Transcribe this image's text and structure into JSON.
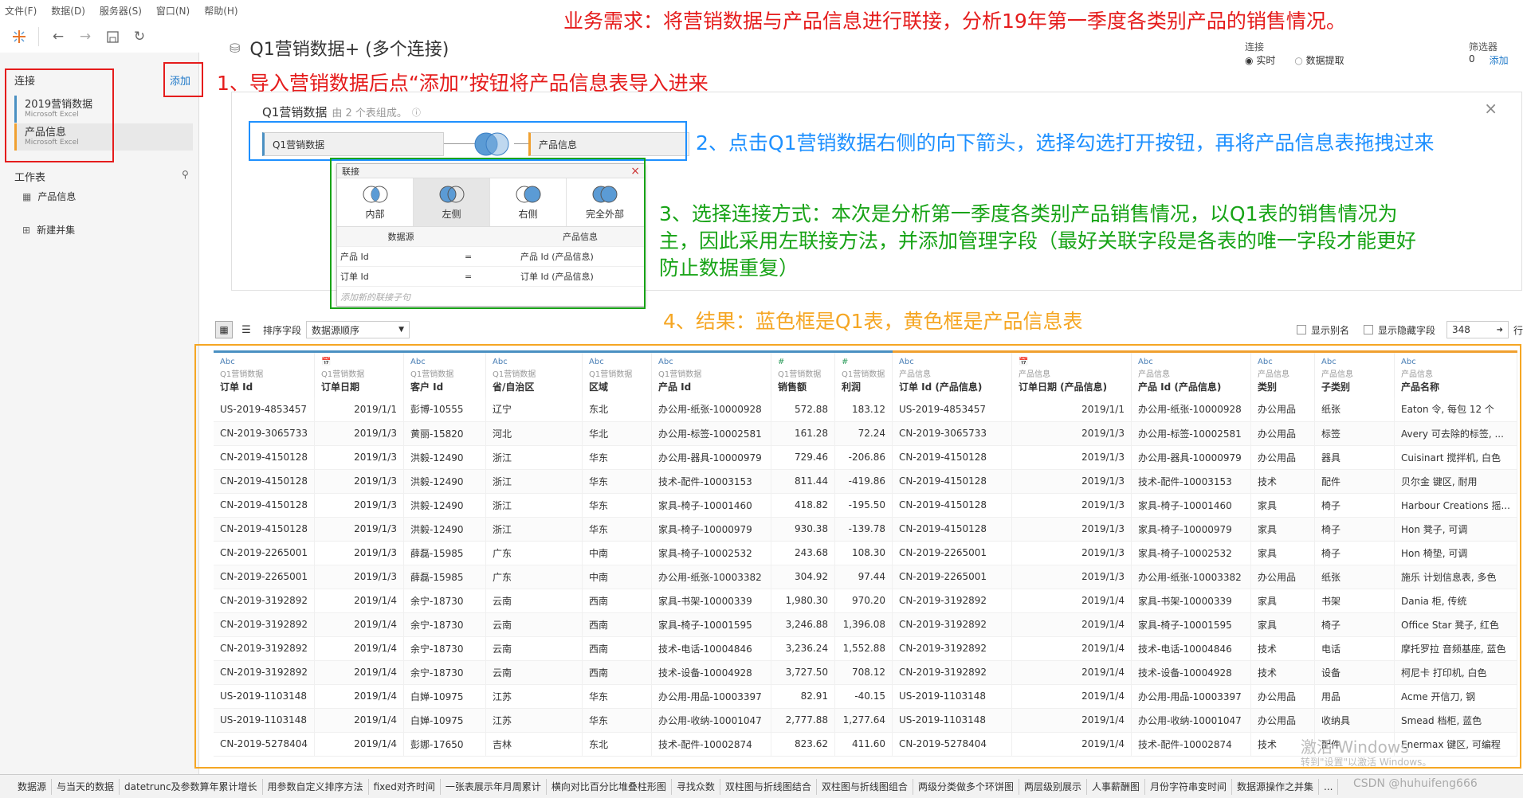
{
  "menu": [
    "文件(F)",
    "数据(D)",
    "服务器(S)",
    "窗口(N)",
    "帮助(H)"
  ],
  "datasource": {
    "title": "Q1营销数据+ (多个连接)"
  },
  "connection_mode": {
    "label": "连接",
    "options": [
      "实时",
      "数据提取"
    ],
    "selected": "实时"
  },
  "filters": {
    "label": "筛选器",
    "count": "0",
    "add": "添加"
  },
  "left": {
    "connections_label": "连接",
    "add_label": "添加",
    "connections": [
      {
        "name": "2019营销数据",
        "type": "Microsoft Excel"
      },
      {
        "name": "产品信息",
        "type": "Microsoft Excel"
      }
    ],
    "sheets_label": "工作表",
    "sheets": [
      {
        "name": "产品信息"
      }
    ],
    "new_union": "新建并集"
  },
  "canvas": {
    "title": "Q1营销数据",
    "subtitle": "由 2 个表组成。",
    "left_table": "Q1营销数据",
    "right_table": "产品信息"
  },
  "join_dialog": {
    "title": "联接",
    "types": [
      "内部",
      "左侧",
      "右侧",
      "完全外部"
    ],
    "selected": "左侧",
    "col_left": "数据源",
    "col_right": "产品信息",
    "clauses": [
      {
        "left": "产品 Id",
        "op": "=",
        "right": "产品 Id (产品信息)"
      },
      {
        "left": "订单 Id",
        "op": "=",
        "right": "订单 Id (产品信息)"
      }
    ],
    "add_clause": "添加新的联接子句"
  },
  "annotations": {
    "top": "业务需求：将营销数据与产品信息进行联接，分析19年第一季度各类别产品的销售情况。",
    "a1": "1、导入营销数据后点“添加”按钮将产品信息表导入进来",
    "a2": "2、点击Q1营销数据右侧的向下箭头，选择勾选打开按钮，再将产品信息表拖拽过来",
    "a3_l1": "3、选择连接方式：本次是分析第一季度各类别产品销售情况，以Q1表的销售情况为",
    "a3_l2": "主，因此采用左联接方法，并添加管理字段（最好关联字段是各表的唯一字段才能更好",
    "a3_l3": "防止数据重复）",
    "a4": "4、结果：蓝色框是Q1表，黄色框是产品信息表"
  },
  "gridbar": {
    "sort_label": "排序字段",
    "sort_value": "数据源顺序",
    "show_alias": "显示别名",
    "show_hidden": "显示隐藏字段",
    "rows": "348",
    "rows_suffix": "行"
  },
  "columns": [
    {
      "type": "Abc",
      "src": "Q1营销数据",
      "name": "订单 Id"
    },
    {
      "type": "date",
      "src": "Q1营销数据",
      "name": "订单日期"
    },
    {
      "type": "Abc",
      "src": "Q1营销数据",
      "name": "客户 Id"
    },
    {
      "type": "Abc",
      "src": "Q1营销数据",
      "name": "省/自治区"
    },
    {
      "type": "Abc",
      "src": "Q1营销数据",
      "name": "区域"
    },
    {
      "type": "Abc",
      "src": "Q1营销数据",
      "name": "产品 Id"
    },
    {
      "type": "#",
      "src": "Q1营销数据",
      "name": "销售额"
    },
    {
      "type": "#",
      "src": "Q1营销数据",
      "name": "利润"
    },
    {
      "type": "Abc",
      "src": "产品信息",
      "name": "订单 Id (产品信息)"
    },
    {
      "type": "date",
      "src": "产品信息",
      "name": "订单日期 (产品信息)"
    },
    {
      "type": "Abc",
      "src": "产品信息",
      "name": "产品 Id (产品信息)"
    },
    {
      "type": "Abc",
      "src": "产品信息",
      "name": "类别"
    },
    {
      "type": "Abc",
      "src": "产品信息",
      "name": "子类别"
    },
    {
      "type": "Abc",
      "src": "产品信息",
      "name": "产品名称"
    }
  ],
  "rows": [
    [
      "US-2019-4853457",
      "2019/1/1",
      "彭博-10555",
      "辽宁",
      "东北",
      "办公用-纸张-10000928",
      "572.88",
      "183.12",
      "US-2019-4853457",
      "2019/1/1",
      "办公用-纸张-10000928",
      "办公用品",
      "纸张",
      "Eaton 令, 每包 12 个"
    ],
    [
      "CN-2019-3065733",
      "2019/1/3",
      "黄丽-15820",
      "河北",
      "华北",
      "办公用-标签-10002581",
      "161.28",
      "72.24",
      "CN-2019-3065733",
      "2019/1/3",
      "办公用-标签-10002581",
      "办公用品",
      "标签",
      "Avery 可去除的标签, ..."
    ],
    [
      "CN-2019-4150128",
      "2019/1/3",
      "洪毅-12490",
      "浙江",
      "华东",
      "办公用-器具-10000979",
      "729.46",
      "-206.86",
      "CN-2019-4150128",
      "2019/1/3",
      "办公用-器具-10000979",
      "办公用品",
      "器具",
      "Cuisinart 搅拌机, 白色"
    ],
    [
      "CN-2019-4150128",
      "2019/1/3",
      "洪毅-12490",
      "浙江",
      "华东",
      "技术-配件-10003153",
      "811.44",
      "-419.86",
      "CN-2019-4150128",
      "2019/1/3",
      "技术-配件-10003153",
      "技术",
      "配件",
      "贝尔金 键区, 耐用"
    ],
    [
      "CN-2019-4150128",
      "2019/1/3",
      "洪毅-12490",
      "浙江",
      "华东",
      "家具-椅子-10001460",
      "418.82",
      "-195.50",
      "CN-2019-4150128",
      "2019/1/3",
      "家具-椅子-10001460",
      "家具",
      "椅子",
      "Harbour Creations 摇..."
    ],
    [
      "CN-2019-4150128",
      "2019/1/3",
      "洪毅-12490",
      "浙江",
      "华东",
      "家具-椅子-10000979",
      "930.38",
      "-139.78",
      "CN-2019-4150128",
      "2019/1/3",
      "家具-椅子-10000979",
      "家具",
      "椅子",
      "Hon 凳子, 可调"
    ],
    [
      "CN-2019-2265001",
      "2019/1/3",
      "薛磊-15985",
      "广东",
      "中南",
      "家具-椅子-10002532",
      "243.68",
      "108.30",
      "CN-2019-2265001",
      "2019/1/3",
      "家具-椅子-10002532",
      "家具",
      "椅子",
      "Hon 椅垫, 可调"
    ],
    [
      "CN-2019-2265001",
      "2019/1/3",
      "薛磊-15985",
      "广东",
      "中南",
      "办公用-纸张-10003382",
      "304.92",
      "97.44",
      "CN-2019-2265001",
      "2019/1/3",
      "办公用-纸张-10003382",
      "办公用品",
      "纸张",
      "施乐 计划信息表, 多色"
    ],
    [
      "CN-2019-3192892",
      "2019/1/4",
      "余宁-18730",
      "云南",
      "西南",
      "家具-书架-10000339",
      "1,980.30",
      "970.20",
      "CN-2019-3192892",
      "2019/1/4",
      "家具-书架-10000339",
      "家具",
      "书架",
      "Dania 柜, 传统"
    ],
    [
      "CN-2019-3192892",
      "2019/1/4",
      "余宁-18730",
      "云南",
      "西南",
      "家具-椅子-10001595",
      "3,246.88",
      "1,396.08",
      "CN-2019-3192892",
      "2019/1/4",
      "家具-椅子-10001595",
      "家具",
      "椅子",
      "Office Star 凳子, 红色"
    ],
    [
      "CN-2019-3192892",
      "2019/1/4",
      "余宁-18730",
      "云南",
      "西南",
      "技术-电话-10004846",
      "3,236.24",
      "1,552.88",
      "CN-2019-3192892",
      "2019/1/4",
      "技术-电话-10004846",
      "技术",
      "电话",
      "摩托罗拉 音频基座, 蓝色"
    ],
    [
      "CN-2019-3192892",
      "2019/1/4",
      "余宁-18730",
      "云南",
      "西南",
      "技术-设备-10004928",
      "3,727.50",
      "708.12",
      "CN-2019-3192892",
      "2019/1/4",
      "技术-设备-10004928",
      "技术",
      "设备",
      "柯尼卡 打印机, 白色"
    ],
    [
      "US-2019-1103148",
      "2019/1/4",
      "白婵-10975",
      "江苏",
      "华东",
      "办公用-用品-10003397",
      "82.91",
      "-40.15",
      "US-2019-1103148",
      "2019/1/4",
      "办公用-用品-10003397",
      "办公用品",
      "用品",
      "Acme 开信刀, 钢"
    ],
    [
      "US-2019-1103148",
      "2019/1/4",
      "白婵-10975",
      "江苏",
      "华东",
      "办公用-收纳-10001047",
      "2,777.88",
      "1,277.64",
      "US-2019-1103148",
      "2019/1/4",
      "办公用-收纳-10001047",
      "办公用品",
      "收纳具",
      "Smead 档柜, 蓝色"
    ],
    [
      "CN-2019-5278404",
      "2019/1/4",
      "彭娜-17650",
      "吉林",
      "东北",
      "技术-配件-10002874",
      "823.62",
      "411.60",
      "CN-2019-5278404",
      "2019/1/4",
      "技术-配件-10002874",
      "技术",
      "配件",
      "Enermax 键区, 可编程"
    ]
  ],
  "tabs": [
    "数据源",
    "与当天的数据",
    "datetrunc及参数算年累计增长",
    "用参数自定义排序方法",
    "fixed对齐时间",
    "一张表展示年月周累计",
    "横向对比百分比堆叠柱形图",
    "寻找众数",
    "双柱图与折线图结合",
    "双柱图与折线图组合",
    "两级分类做多个环饼图",
    "两层级别展示",
    "人事薪酬图",
    "月份字符串变时间",
    "数据源操作之并集",
    "..."
  ],
  "watermark": "激活 Windows",
  "watermark2": "转到\"设置\"以激活 Windows。",
  "credit": "CSDN @huhuifeng666"
}
